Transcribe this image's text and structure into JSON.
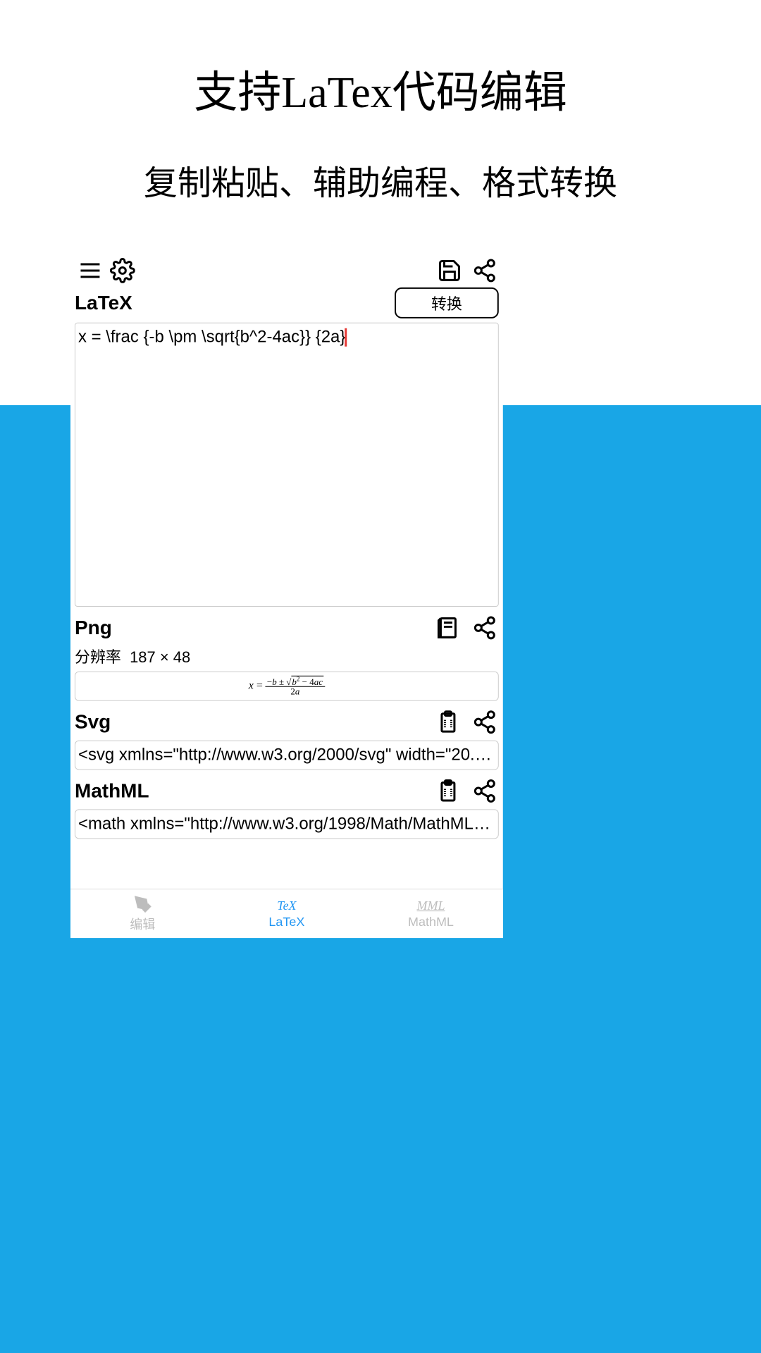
{
  "promo": {
    "title": "支持LaTex代码编辑",
    "subtitle": "复制粘贴、辅助编程、格式转换"
  },
  "toolbar": {
    "convert_label": "转换"
  },
  "latex": {
    "section_label": "LaTeX",
    "code": "x = \\frac {-b \\pm \\sqrt{b^2-4ac}} {2a}"
  },
  "png": {
    "section_label": "Png",
    "resolution_label": "分辨率",
    "resolution_value": "187 × 48"
  },
  "svg": {
    "section_label": "Svg",
    "code": "<svg xmlns=\"http://www.w3.org/2000/svg\" width=\"20.7…"
  },
  "mathml": {
    "section_label": "MathML",
    "code": "<math xmlns=\"http://www.w3.org/1998/Math/MathML\" …"
  },
  "tabs": {
    "edit": {
      "label": "编辑"
    },
    "latex": {
      "icon_text": "TeX",
      "label": "LaTeX"
    },
    "mathml": {
      "icon_text": "MML",
      "label": "MathML"
    }
  }
}
